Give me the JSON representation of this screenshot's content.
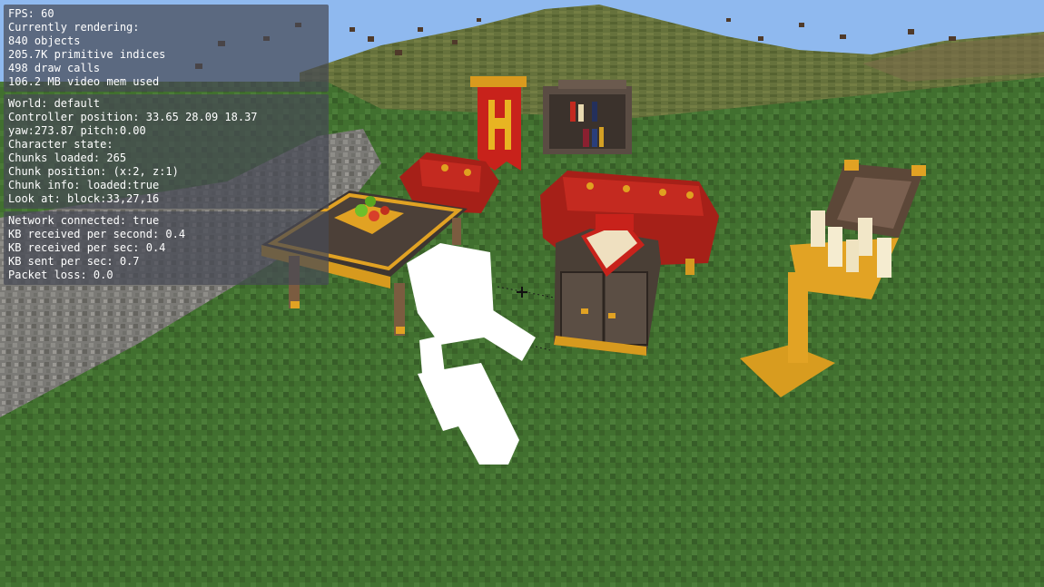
{
  "debug": {
    "performance": [
      "FPS: 60",
      "Currently rendering:",
      "840 objects",
      "205.7K primitive indices",
      "498 draw calls",
      "106.2 MB video mem used"
    ],
    "world": [
      "World: default",
      "Controller position: 33.65 28.09 18.37",
      "yaw:273.87 pitch:0.00",
      "Character state:",
      "Chunks loaded: 265",
      "Chunk position: (x:2, z:1)",
      "Chunk info: loaded:true",
      "Look at: block:33,27,16"
    ],
    "network": [
      "Network connected: true",
      "KB received per second: 0.4",
      "KB received per sec: 0.4",
      "KB sent per sec: 0.7",
      "Packet loss: 0.0"
    ]
  },
  "colors": {
    "sky": "#8fb8f0",
    "grass": "#3f6a30",
    "hill": "#5d6a34",
    "stone": "#7c7b77",
    "red_fabric": "#b3231c",
    "gold": "#e2a324",
    "dark_wood": "#4a3f36",
    "avatar": "#ffffff"
  }
}
